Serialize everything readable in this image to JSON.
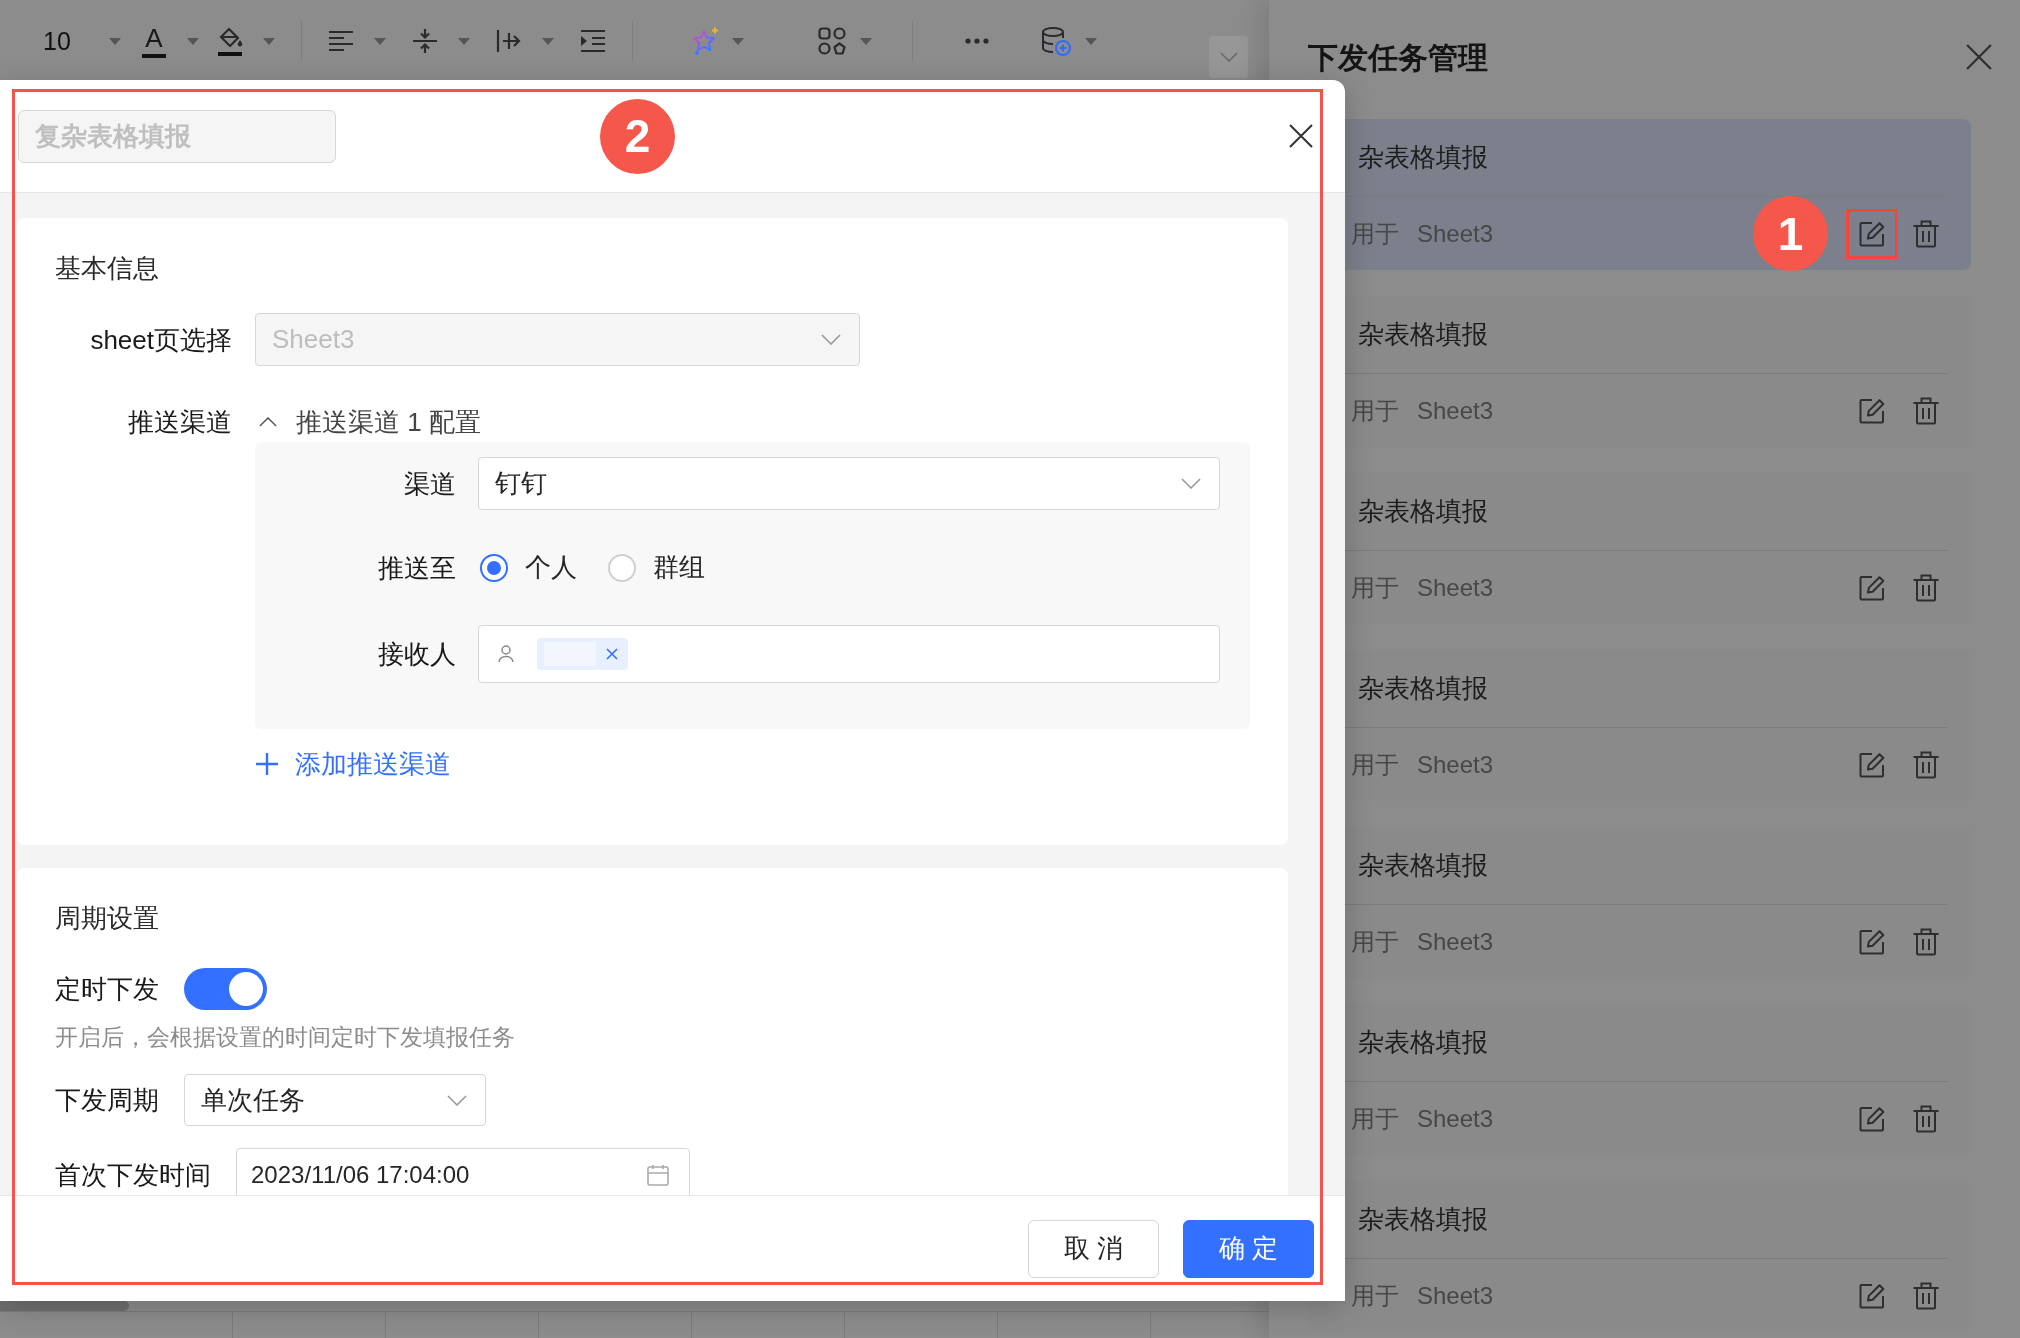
{
  "toolbar": {
    "font_size": "10",
    "font_color_glyph": "A"
  },
  "drawer": {
    "title": "下发任务管理",
    "tasks": [
      {
        "title": "杂表格填报",
        "applies_label": "用于",
        "sheet": "Sheet3",
        "selected": true,
        "marked": true,
        "badge": "1"
      },
      {
        "title": "杂表格填报",
        "applies_label": "用于",
        "sheet": "Sheet3",
        "selected": false,
        "marked": false
      },
      {
        "title": "杂表格填报",
        "applies_label": "用于",
        "sheet": "Sheet3",
        "selected": false,
        "marked": false
      },
      {
        "title": "杂表格填报",
        "applies_label": "用于",
        "sheet": "Sheet3",
        "selected": false,
        "marked": false
      },
      {
        "title": "杂表格填报",
        "applies_label": "用于",
        "sheet": "Sheet3",
        "selected": false,
        "marked": false
      },
      {
        "title": "杂表格填报",
        "applies_label": "用于",
        "sheet": "Sheet3",
        "selected": false,
        "marked": false
      },
      {
        "title": "杂表格填报",
        "applies_label": "用于",
        "sheet": "Sheet3",
        "selected": false,
        "marked": false
      }
    ]
  },
  "modal": {
    "annotation_frame": true,
    "title_field": {
      "value": "复杂表格填报",
      "disabled": true
    },
    "badge": "2",
    "basic_info": {
      "title": "基本信息",
      "sheet_label": "sheet页选择",
      "sheet_select": {
        "value": "Sheet3",
        "disabled": true
      },
      "channels_label": "推送渠道",
      "channels": [
        {
          "title": "推送渠道 1 配置",
          "expanded": true,
          "channel_label": "渠道",
          "channel_value": "钉钉",
          "push_to_label": "推送至",
          "push_to_options": [
            {
              "label": "个人",
              "selected": true
            },
            {
              "label": "群组",
              "selected": false
            }
          ],
          "receiver_label": "接收人",
          "receivers": [
            {
              "kind": "redacted"
            }
          ]
        }
      ],
      "add_channel": "添加推送渠道"
    },
    "schedule": {
      "title": "周期设置",
      "timed_label": "定时下发",
      "timed_on": true,
      "hint": "开启后，会根据设置的时间定时下发填报任务",
      "period_label": "下发周期",
      "period_value": "单次任务",
      "first_time_label": "首次下发时间",
      "first_time_value": "2023/11/06 17:04:00"
    },
    "buttons": [
      {
        "label": "取 消",
        "kind": "default"
      },
      {
        "label": "确 定",
        "kind": "primary"
      }
    ]
  }
}
